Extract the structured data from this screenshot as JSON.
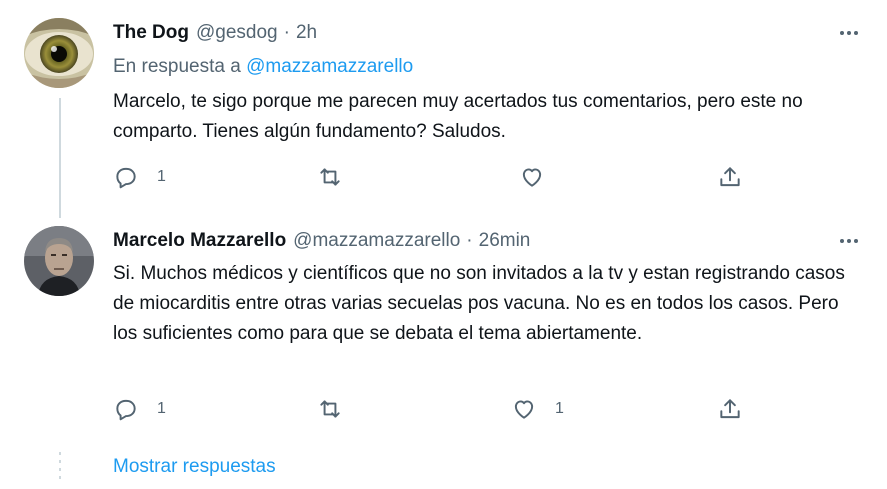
{
  "tweets": [
    {
      "name": "The Dog",
      "handle": "@gesdog",
      "separator": "·",
      "time": "2h",
      "reply_prefix": "En respuesta a ",
      "reply_mention": "@mazzamazzarello",
      "text": "Marcelo, te sigo porque me parecen muy acertados tus comentarios, pero este no comparto. Tienes algún fundamento? Saludos.",
      "reply_count": "1",
      "retweet_count": "",
      "like_count": ""
    },
    {
      "name": "Marcelo Mazzarello",
      "handle": "@mazzamazzarello",
      "separator": "·",
      "time": "26min",
      "text": "Si. Muchos médicos y científicos que no son invitados a la tv y estan registrando casos de miocarditis entre otras varias secuelas pos vacuna. No es en todos los casos. Pero los suficientes como para que se debata el tema abiertamente.",
      "reply_count": "1",
      "retweet_count": "",
      "like_count": "1"
    }
  ],
  "show_replies_label": "Mostrar respuestas",
  "icons": {
    "reply": "reply-icon",
    "retweet": "retweet-icon",
    "like": "heart-icon",
    "share": "share-icon",
    "more": "more-icon"
  },
  "colors": {
    "link": "#1d9bf0",
    "secondary_text": "#536471",
    "primary_text": "#0f1419",
    "thread_line": "#cfd9de"
  }
}
